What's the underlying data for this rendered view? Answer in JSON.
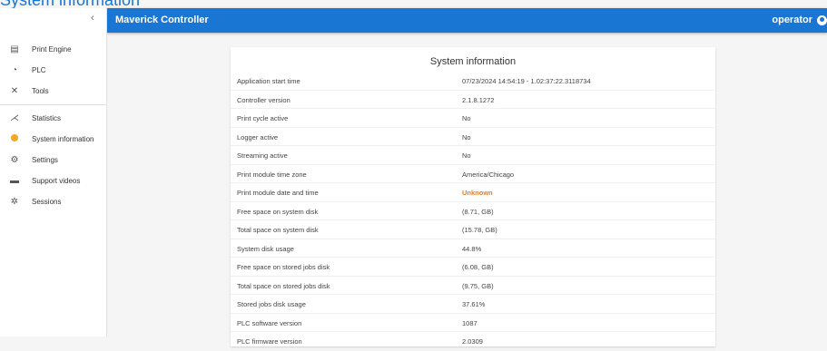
{
  "page_heading": "System information",
  "header": {
    "app_title": "Maverick Controller",
    "user": "operator"
  },
  "sidebar": {
    "collapse_icon": "chevron-left-icon",
    "items": [
      {
        "label": "Print Engine",
        "icon": "printer-icon"
      },
      {
        "label": "PLC",
        "icon": "gauge-icon"
      },
      {
        "label": "Tools",
        "icon": "tools-icon"
      },
      {
        "label": "Statistics",
        "icon": "chart-icon"
      },
      {
        "label": "System information",
        "icon": "status-dot-icon",
        "color": "#f5a623"
      },
      {
        "label": "Settings",
        "icon": "gears-icon"
      },
      {
        "label": "Support videos",
        "icon": "video-icon"
      },
      {
        "label": "Sessions",
        "icon": "sessions-icon"
      }
    ]
  },
  "card": {
    "title": "System information",
    "rows": [
      {
        "label": "Application start time",
        "value": "07/23/2024 14:54:19 - 1.02:37:22.3118734"
      },
      {
        "label": "Controller version",
        "value": "2.1.8.1272"
      },
      {
        "label": "Print cycle active",
        "value": "No"
      },
      {
        "label": "Logger active",
        "value": "No"
      },
      {
        "label": "Streaming active",
        "value": "No"
      },
      {
        "label": "Print module time zone",
        "value": "America/Chicago"
      },
      {
        "label": "Print module date and time",
        "value": "Unknown",
        "color": "#e67e22"
      },
      {
        "label": "Free space on system disk",
        "value": "(8.71, GB)"
      },
      {
        "label": "Total space on system disk",
        "value": "(15.78, GB)"
      },
      {
        "label": "System disk usage",
        "value": "44.8%"
      },
      {
        "label": "Free space on stored jobs disk",
        "value": "(6.08, GB)"
      },
      {
        "label": "Total space on stored jobs disk",
        "value": "(9.75, GB)"
      },
      {
        "label": "Stored jobs disk usage",
        "value": "37.61%"
      },
      {
        "label": "PLC software version",
        "value": "1087"
      },
      {
        "label": "PLC firmware version",
        "value": "2.0309"
      }
    ]
  }
}
